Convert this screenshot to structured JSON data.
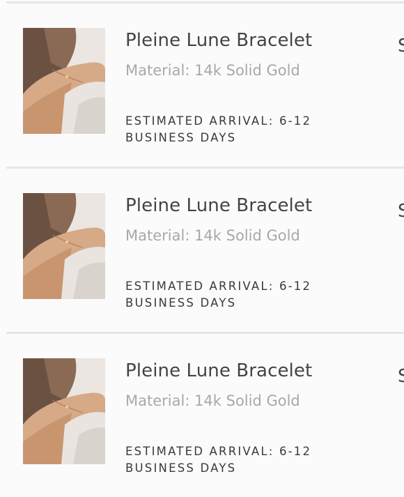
{
  "cart": {
    "items": [
      {
        "title": "Pleine Lune Bracelet",
        "material": "Material: 14k Solid Gold",
        "arrival": "ESTIMATED ARRIVAL: 6-12 BUSINESS DAYS",
        "edge_text": "S"
      },
      {
        "title": "Pleine Lune Bracelet",
        "material": "Material: 14k Solid Gold",
        "arrival": "ESTIMATED ARRIVAL: 6-12 BUSINESS DAYS",
        "edge_text": "S"
      },
      {
        "title": "Pleine Lune Bracelet",
        "material": "Material: 14k Solid Gold",
        "arrival": "ESTIMATED ARRIVAL: 6-12 BUSINESS DAYS",
        "edge_text": "S"
      }
    ]
  }
}
